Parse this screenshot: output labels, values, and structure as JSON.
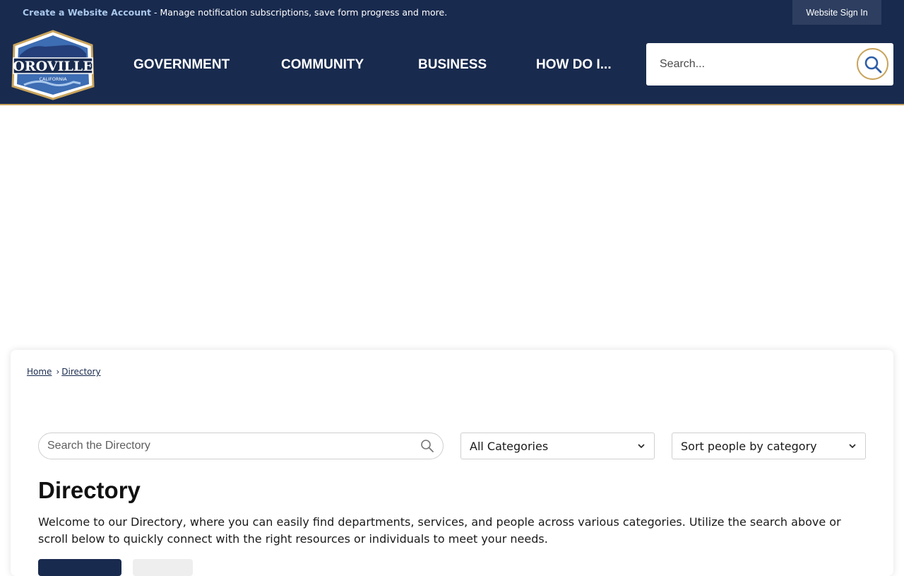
{
  "topbar": {
    "create_account_label": "Create a Website Account",
    "message": " - Manage notification subscriptions, save form progress and more.",
    "signin_label": "Website Sign In"
  },
  "logo": {
    "name": "OROVILLE",
    "state": "CALIFORNIA"
  },
  "nav": {
    "items": [
      {
        "label": "GOVERNMENT"
      },
      {
        "label": "COMMUNITY"
      },
      {
        "label": "BUSINESS"
      },
      {
        "label": "HOW DO I..."
      }
    ]
  },
  "site_search": {
    "placeholder": "Search..."
  },
  "breadcrumb": {
    "home": "Home",
    "separator": "›",
    "current": "Directory"
  },
  "directory": {
    "search_placeholder": "Search the Directory",
    "category_selected": "All Categories",
    "sort_selected": "Sort people by category",
    "title": "Directory",
    "intro": "Welcome to our Directory, where you can easily find departments, services, and people across various categories. Utilize the search above or scroll below to quickly connect with the right resources or individuals to meet your needs."
  },
  "colors": {
    "navy": "#182a4e",
    "gold": "#c9a45c",
    "link_light": "#a9c8ec",
    "signin_bg": "#2d3e60"
  }
}
